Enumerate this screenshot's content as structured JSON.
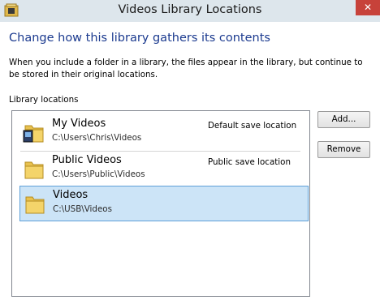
{
  "window": {
    "title": "Videos Library Locations",
    "close_label": "✕"
  },
  "heading": "Change how this library gathers its contents",
  "description": "When you include a folder in a library, the files appear in the library, but continue to be stored in their original locations.",
  "locations_label": "Library locations",
  "locations": [
    {
      "name": "My Videos",
      "path": "C:\\Users\\Chris\\Videos",
      "status": "Default save location",
      "selected": false,
      "icon": "video-folder-icon"
    },
    {
      "name": "Public Videos",
      "path": "C:\\Users\\Public\\Videos",
      "status": "Public save location",
      "selected": false,
      "icon": "folder-icon"
    },
    {
      "name": "Videos",
      "path": "C:\\USB\\Videos",
      "status": "",
      "selected": true,
      "icon": "folder-icon"
    }
  ],
  "buttons": {
    "add_label": "Add...",
    "remove_label": "Remove"
  },
  "colors": {
    "heading": "#1b3a8f",
    "selection": "#cce4f7",
    "close": "#c7423a"
  }
}
